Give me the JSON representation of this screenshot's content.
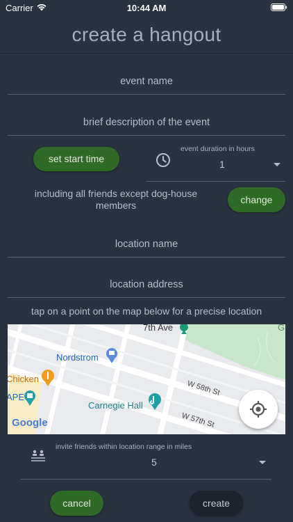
{
  "status_bar": {
    "carrier": "Carrier",
    "time": "10:44 AM"
  },
  "title": "create a hangout",
  "form": {
    "event_name_placeholder": "event name",
    "description_placeholder": "brief description of the event",
    "set_start_time_label": "set start time",
    "duration_label": "event duration in hours",
    "duration_value": "1",
    "friends_text": "including all friends except dog-house members",
    "change_label": "change",
    "location_name_placeholder": "location name",
    "location_address_placeholder": "location address",
    "map_hint": "tap on a point on the map below for a precise location",
    "range_label": "invite friends within location range in miles",
    "range_value": "5",
    "cancel_label": "cancel",
    "create_label": "create"
  },
  "map": {
    "labels": {
      "seventh_ave": "7th Ave",
      "nordstrom": "Nordstrom",
      "chicken": "Chicken",
      "ape": "APE",
      "carnegie_hall": "Carnegie Hall",
      "w58": "W 58th St",
      "w57": "W 57th St",
      "google": "Google",
      "g": "G"
    }
  },
  "colors": {
    "background": "#29323f",
    "green_button": "#2f6b26",
    "dark_button": "#1c232c"
  },
  "icons": [
    "wifi-icon",
    "battery-icon",
    "clock-icon",
    "chevron-down-icon",
    "my-location-icon",
    "people-range-icon"
  ]
}
